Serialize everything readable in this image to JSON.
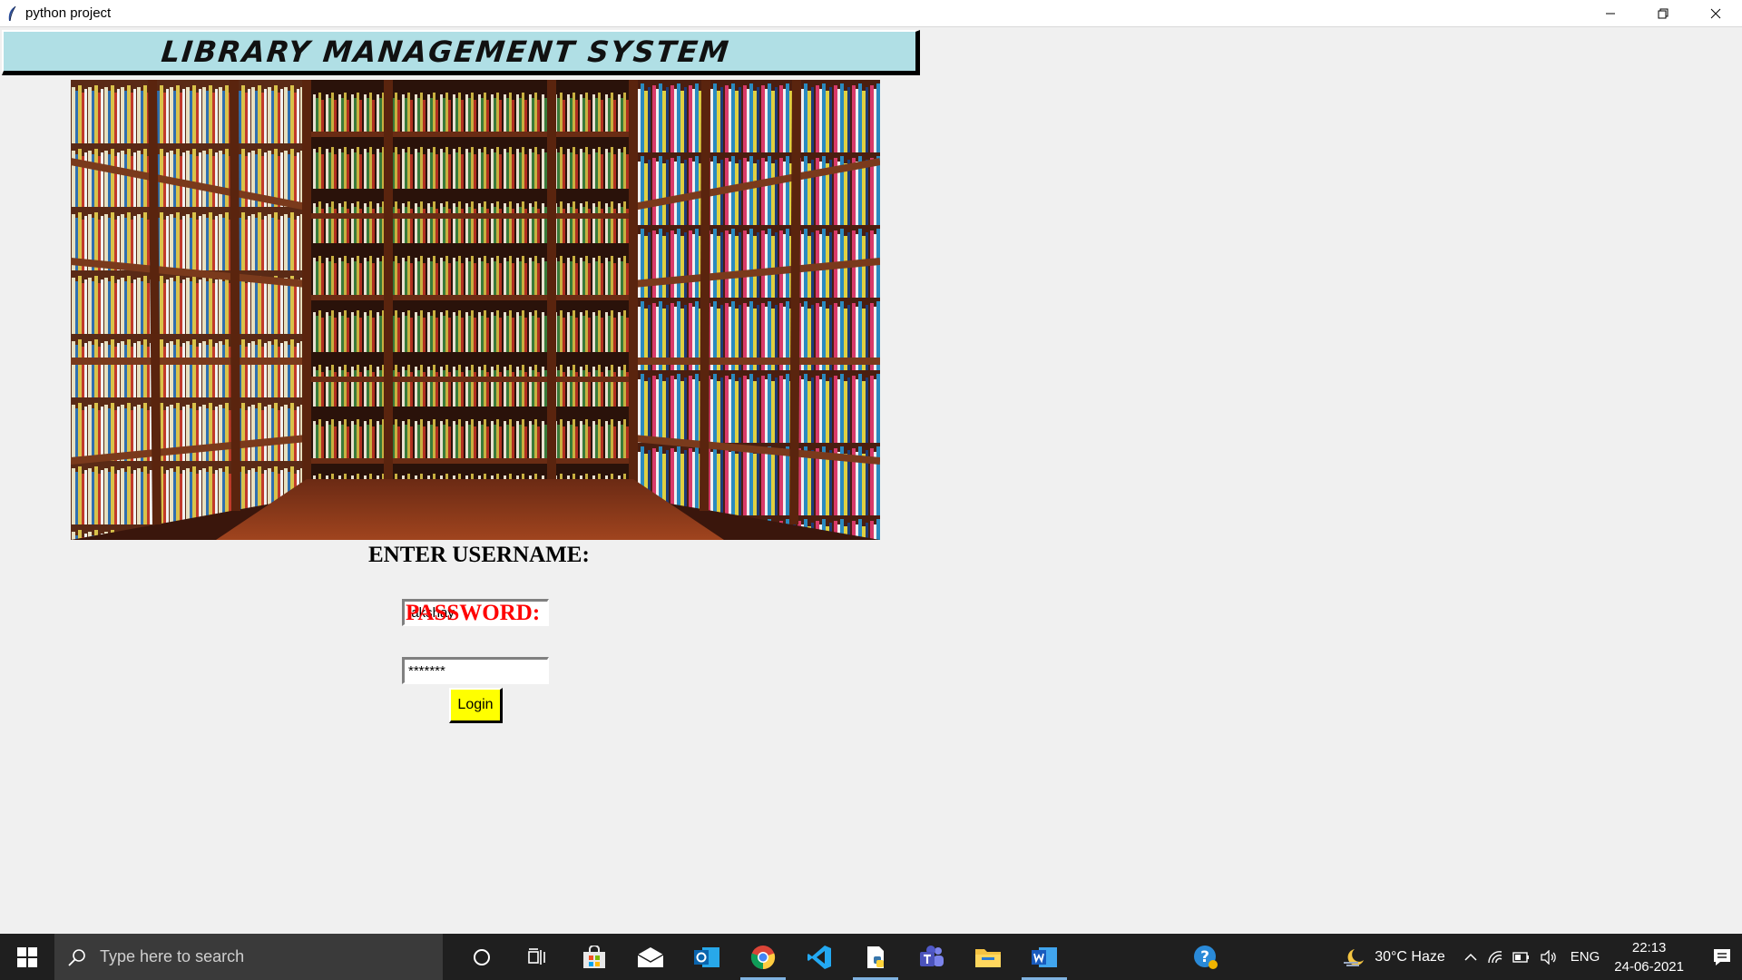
{
  "window": {
    "title": "python project"
  },
  "header": {
    "title": "LIBRARY MANAGEMENT SYSTEM",
    "bg_color": "#b0dfe5"
  },
  "login_form": {
    "username_label": "ENTER USERNAME:",
    "username_value": "lakshay",
    "password_label": "PASSWORD:",
    "password_value": "*******",
    "login_button": "Login",
    "password_label_color": "#ff0000",
    "button_color": "#ffff00"
  },
  "taskbar": {
    "search_placeholder": "Type here to search",
    "icons": [
      "cortana-icon",
      "task-view-icon",
      "store-icon",
      "mail-icon",
      "outlook-icon",
      "chrome-icon",
      "vscode-icon",
      "python-editor-icon",
      "teams-icon",
      "file-explorer-icon",
      "word-icon"
    ],
    "weather": "30°C  Haze",
    "language": "ENG",
    "time": "22:13",
    "date": "24-06-2021"
  }
}
